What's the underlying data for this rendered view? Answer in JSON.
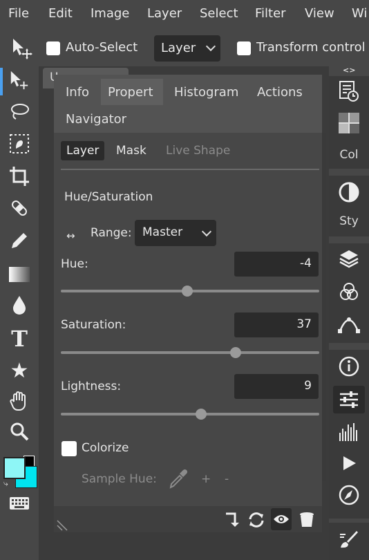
{
  "menu": {
    "items": [
      "File",
      "Edit",
      "Image",
      "Layer",
      "Select",
      "Filter",
      "View",
      "Wi"
    ]
  },
  "toolbar": {
    "auto_select_label": "Auto-Select",
    "layer_select_value": "Layer",
    "transform_controls_label": "Transform control"
  },
  "document_tab": {
    "label": "U"
  },
  "right_panel": {
    "toggle_label": "<>",
    "col_label": "Col",
    "sty_label": "Sty"
  },
  "panel": {
    "tabs": [
      "Info",
      "Propert",
      "Histogram",
      "Actions",
      "Navigator"
    ],
    "active_tab": "Propert",
    "subtabs": [
      "Layer",
      "Mask",
      "Live Shape"
    ],
    "active_subtab": "Layer",
    "adjustment_title": "Hue/Saturation",
    "range_label": "Range:",
    "range_icon": "↔",
    "range_value": "Master",
    "hue_label": "Hue:",
    "hue_value": "-4",
    "saturation_label": "Saturation:",
    "saturation_value": "37",
    "lightness_label": "Lightness:",
    "lightness_value": "9",
    "colorize_label": "Colorize",
    "colorize_checked": false,
    "sample_hue_label": "Sample Hue:",
    "plus_label": "+",
    "minus_label": "-"
  },
  "colors": {
    "foreground": "#8ef6f6",
    "background": "#00e5f0",
    "accent": "#4aa0f0"
  }
}
